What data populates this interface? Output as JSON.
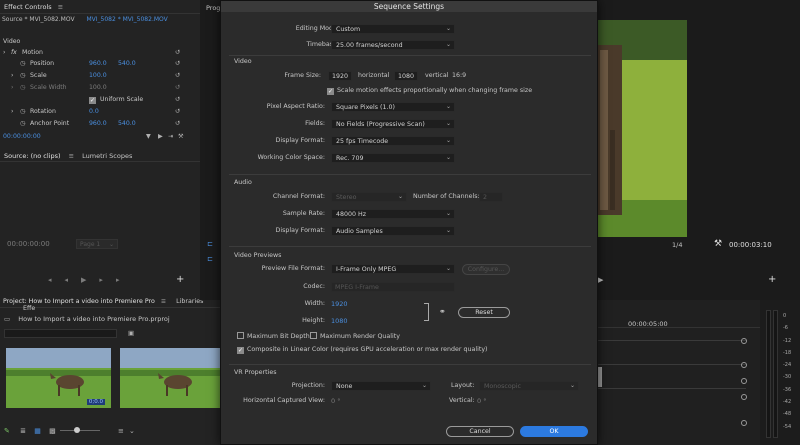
{
  "effect_controls": {
    "tab": "Effect Controls",
    "menu_icon": "hamburger-icon",
    "source_label": "Source * MVI_5082.MOV",
    "clip_label": "MVI_5082 * MVI_5082.MOV",
    "video_header": "Video",
    "fx": "fx",
    "motion": "Motion",
    "rows": [
      {
        "label": "Position",
        "v1": "960.0",
        "v2": "540.0"
      },
      {
        "label": "Scale",
        "v1": "100.0",
        "v2": ""
      },
      {
        "label": "Scale Width",
        "v1": "100.0",
        "v2": ""
      },
      {
        "label": "Uniform Scale",
        "v1": "",
        "v2": ""
      },
      {
        "label": "Rotation",
        "v1": "0.0",
        "v2": ""
      },
      {
        "label": "Anchor Point",
        "v1": "960.0",
        "v2": "540.0"
      }
    ],
    "timecode": "00:00:00:00"
  },
  "source": {
    "tab": "Source: (no clips)",
    "tab2": "Lumetri Scopes",
    "timecode": "00:00:00:00",
    "page": "Page 1"
  },
  "project": {
    "tab": "Project: How to Import a video into Premiere Pro",
    "menu": "≡",
    "tab2": "Libraries",
    "tab3": "Effe",
    "file": "How to Import a video into Premiere Pro.prproj",
    "badge": "0;0.0"
  },
  "program": {
    "tab": "Prog",
    "zoom": "1/4",
    "timecode": "00:00:03:10"
  },
  "timeline": {
    "time": "00:00:05:00"
  },
  "meter": {
    "labels": [
      "0",
      "-6",
      "-12",
      "-18",
      "-24",
      "-30",
      "-36",
      "-42",
      "-48",
      "-54"
    ]
  },
  "dialog": {
    "title": "Sequence Settings",
    "editing_mode_label": "Editing Mode:",
    "editing_mode": "Custom",
    "timebase_label": "Timebase:",
    "timebase": "25.00 frames/second",
    "video_section": "Video",
    "frame_size_label": "Frame Size:",
    "frame_w": "1920",
    "horizontal": "horizontal",
    "frame_h": "1080",
    "vertical": "vertical",
    "aspect": "16:9",
    "scale_motion": "Scale motion effects proportionally when changing frame size",
    "par_label": "Pixel Aspect Ratio:",
    "par": "Square Pixels (1.0)",
    "fields_label": "Fields:",
    "fields": "No Fields (Progressive Scan)",
    "display_format_label": "Display Format:",
    "display_format": "25 fps Timecode",
    "working_color_label": "Working Color Space:",
    "working_color": "Rec. 709",
    "audio_section": "Audio",
    "channel_format_label": "Channel Format:",
    "channel_format": "Stereo",
    "num_channels_label": "Number of Channels:",
    "num_channels": "2",
    "sample_rate_label": "Sample Rate:",
    "sample_rate": "48000 Hz",
    "audio_display_label": "Display Format:",
    "audio_display": "Audio Samples",
    "previews_section": "Video Previews",
    "preview_format_label": "Preview File Format:",
    "preview_format": "I-Frame Only MPEG",
    "configure": "Configure...",
    "codec_label": "Codec:",
    "codec": "MPEG I-Frame",
    "width_label": "Width:",
    "width": "1920",
    "height_label": "Height:",
    "height": "1080",
    "reset": "Reset",
    "max_bit_depth": "Maximum Bit Depth",
    "max_render": "Maximum Render Quality",
    "composite": "Composite in Linear Color (requires GPU acceleration or max render quality)",
    "vr_section": "VR Properties",
    "projection_label": "Projection:",
    "projection": "None",
    "layout_label": "Layout:",
    "layout": "Monoscopic",
    "hcv_label": "Horizontal Captured View:",
    "hcv": "0 °",
    "vertical_label": "Vertical:",
    "vertical_val": "0 °",
    "cancel": "Cancel",
    "ok": "OK"
  }
}
